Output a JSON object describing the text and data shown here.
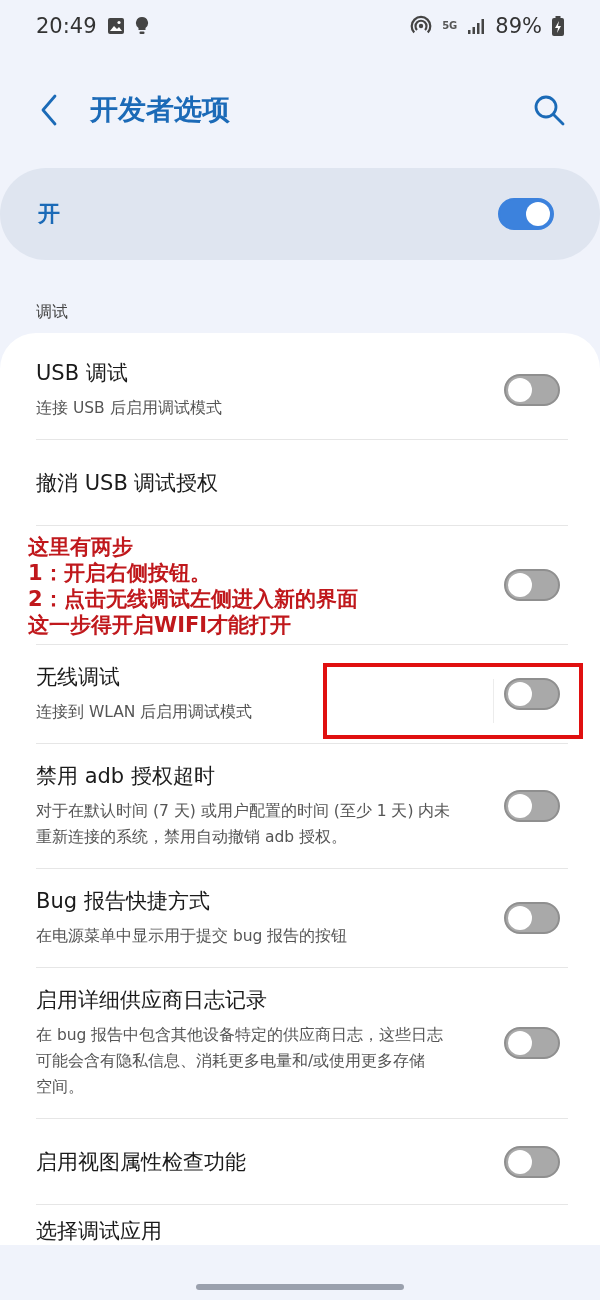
{
  "status_bar": {
    "time": "20:49",
    "network": "5G",
    "battery": "89%"
  },
  "header": {
    "title": "开发者选项"
  },
  "master_switch": {
    "label": "开",
    "on": true
  },
  "section": {
    "title": "调试"
  },
  "rows": [
    {
      "kind": "switch",
      "title": "USB 调试",
      "subtitle": [
        "连接 USB 后启用调试模式"
      ],
      "on": false,
      "highlighted": false
    },
    {
      "kind": "plain",
      "title": "撤消 USB 调试授权"
    },
    {
      "kind": "annotated",
      "annotation": [
        "这里有两步",
        "1：开启右侧按钮。",
        "2：点击无线调试左侧进入新的界面",
        "这一步得开启WIFI才能打开"
      ],
      "on": false,
      "highlighted": false
    },
    {
      "kind": "switch",
      "title": "无线调试",
      "subtitle": [
        "连接到 WLAN 后启用调试模式"
      ],
      "on": false,
      "highlighted": true
    },
    {
      "kind": "switch",
      "title": "禁用 adb 授权超时",
      "subtitle": [
        "对于在默认时间 (7 天) 或用户配置的时间 (至少 1 天) 内未",
        "重新连接的系统，禁用自动撤销 adb 授权。"
      ],
      "on": false,
      "highlighted": false
    },
    {
      "kind": "switch",
      "title": "Bug 报告快捷方式",
      "subtitle": [
        "在电源菜单中显示用于提交 bug 报告的按钮"
      ],
      "on": false,
      "highlighted": false
    },
    {
      "kind": "switch",
      "title": "启用详细供应商日志记录",
      "subtitle": [
        "在 bug 报告中包含其他设备特定的供应商日志，这些日志",
        "可能会含有隐私信息、消耗更多电量和/或使用更多存储",
        "空间。"
      ],
      "on": false,
      "highlighted": false
    },
    {
      "kind": "switch",
      "title": "启用视图属性检查功能",
      "subtitle": [],
      "on": false,
      "highlighted": false
    },
    {
      "kind": "plain",
      "title": "选择调试应用"
    }
  ]
}
